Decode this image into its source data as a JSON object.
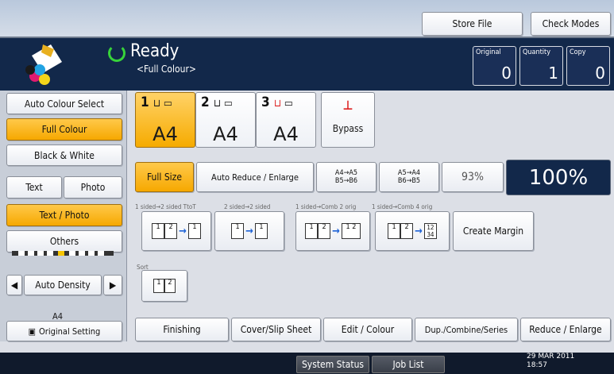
{
  "header": {
    "store_file": "Store File",
    "check_modes": "Check Modes"
  },
  "status": {
    "ready": "Ready",
    "mode": "<Full Colour>"
  },
  "counters": {
    "original": {
      "label": "Original",
      "value": "0"
    },
    "quantity": {
      "label": "Quantity",
      "value": "1"
    },
    "copy": {
      "label": "Copy",
      "value": "0"
    }
  },
  "color_mode": {
    "auto": "Auto Colour Select",
    "full": "Full Colour",
    "bw": "Black & White"
  },
  "original_type": {
    "text": "Text",
    "photo": "Photo",
    "text_photo": "Text / Photo",
    "others": "Others"
  },
  "density": {
    "label": "Auto Density"
  },
  "original_setting": {
    "size": "A4",
    "label": "Original Setting"
  },
  "trays": [
    {
      "num": "1",
      "size": "A4"
    },
    {
      "num": "2",
      "size": "A4"
    },
    {
      "num": "3",
      "size": "A4"
    }
  ],
  "bypass": "Bypass",
  "reduce": {
    "full_size": "Full Size",
    "auto_reduce": "Auto Reduce / Enlarge",
    "r1a": "A4→A5",
    "r1b": "B5→B6",
    "r2a": "A5→A4",
    "r2b": "B6→B5",
    "pct": "93%",
    "zoom": "100%"
  },
  "duplex": {
    "l1": "1 sided→2 sided TtoT",
    "l2": "2 sided→2 sided",
    "l3": "1 sided→Comb 2 orig",
    "l4": "1 sided→Comb 4 orig",
    "create_margin": "Create Margin"
  },
  "sort": {
    "label": "Sort"
  },
  "tabs": {
    "finishing": "Finishing",
    "cover": "Cover/Slip Sheet",
    "edit": "Edit / Colour",
    "dup": "Dup./Combine/Series",
    "reduce": "Reduce / Enlarge"
  },
  "footer": {
    "system_status": "System Status",
    "job_list": "Job List",
    "date": "29 MAR  2011",
    "time": "18:57"
  },
  "colors": {
    "selected": "#f6a800",
    "status_bg": "#12284a",
    "ready_green": "#37d33a"
  }
}
